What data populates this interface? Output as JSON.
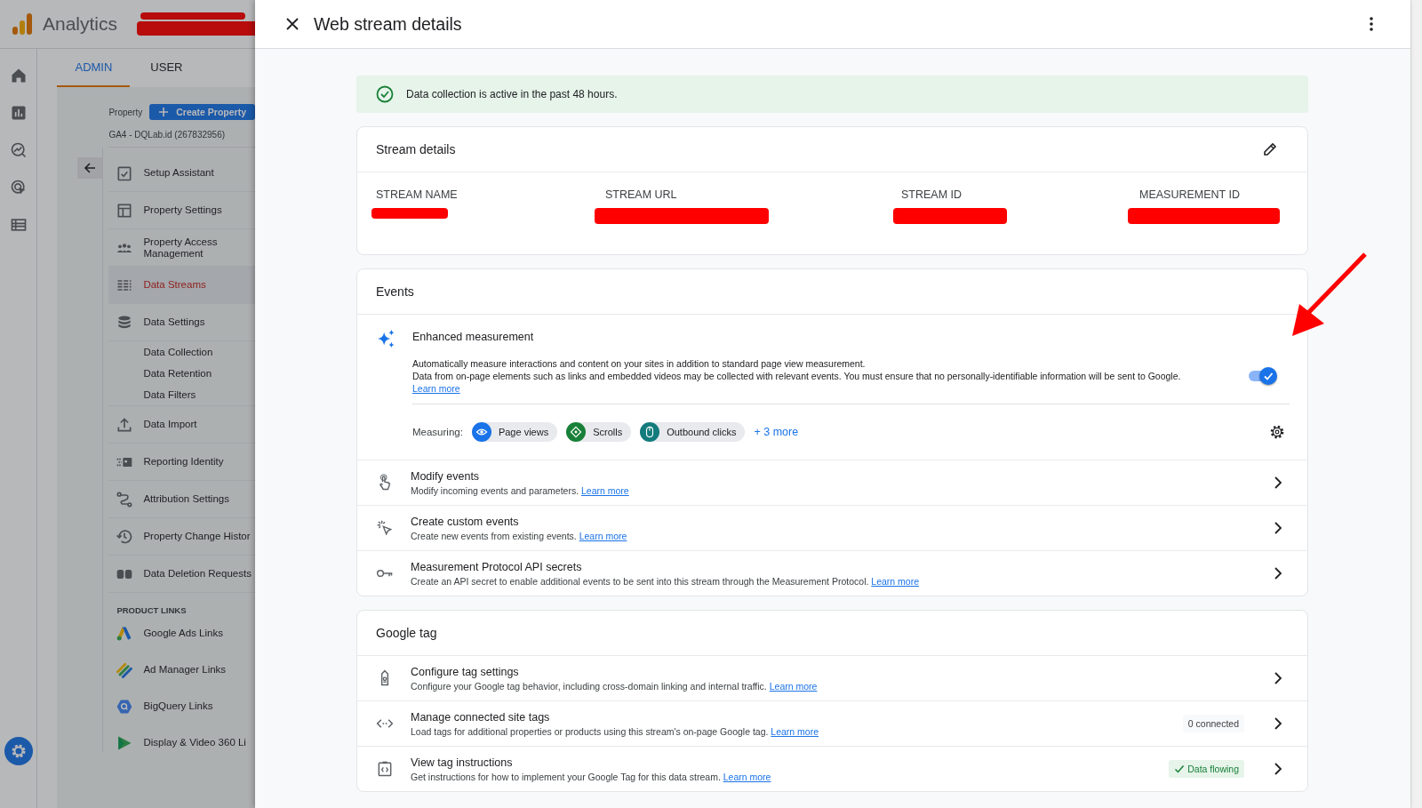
{
  "app": {
    "name": "Analytics",
    "property_redacted": true,
    "tabs": [
      {
        "label": "ADMIN",
        "selected": true
      },
      {
        "label": "USER",
        "selected": false
      }
    ],
    "property_label": "Property",
    "create_button": "Create Property",
    "property_name": "GA4 - DQLab.id (267832956)",
    "nav": [
      {
        "label": "Setup Assistant",
        "selected": false
      },
      {
        "label": "Property Settings",
        "selected": false
      },
      {
        "label": "Property Access Management",
        "selected": false
      },
      {
        "label": "Data Streams",
        "selected": true
      },
      {
        "label": "Data Settings",
        "selected": false,
        "children": [
          {
            "label": "Data Collection",
            "selected": false
          },
          {
            "label": "Data Retention",
            "selected": false
          },
          {
            "label": "Data Filters",
            "selected": false
          }
        ]
      },
      {
        "label": "Data Import",
        "selected": false
      },
      {
        "label": "Reporting Identity",
        "selected": false
      },
      {
        "label": "Attribution Settings",
        "selected": false
      },
      {
        "label": "Property Change Histor",
        "selected": false
      },
      {
        "label": "Data Deletion Requests",
        "selected": false
      }
    ],
    "links_heading": "PRODUCT LINKS",
    "product_links": [
      {
        "label": "Google Ads Links"
      },
      {
        "label": "Ad Manager Links"
      },
      {
        "label": "BigQuery Links"
      },
      {
        "label": "Display & Video 360 Li"
      }
    ]
  },
  "panel": {
    "title": "Web stream details",
    "banner": "Data collection is active in the past 48 hours.",
    "stream_details": {
      "title": "Stream details",
      "fields": [
        {
          "label": "STREAM NAME",
          "redacted": true
        },
        {
          "label": "STREAM URL",
          "redacted": true
        },
        {
          "label": "STREAM ID",
          "redacted": true
        },
        {
          "label": "MEASUREMENT ID",
          "redacted": true
        }
      ]
    },
    "events": {
      "title": "Events",
      "enhanced": {
        "title": "Enhanced measurement",
        "description": "Automatically measure interactions and content on your sites in addition to standard page view measurement.",
        "note": "Data from on-page elements such as links and embedded videos may be collected with relevant events. You must ensure that no personally-identifiable information will be sent to Google.",
        "link": "Learn more",
        "on": true,
        "measuring_label": "Measuring:",
        "chips": [
          {
            "label": "Page views",
            "color": "#1a73e8"
          },
          {
            "label": "Scrolls",
            "color": "#188038"
          },
          {
            "label": "Outbound clicks",
            "color": "#137b7c"
          }
        ],
        "more": "+ 3 more"
      },
      "rows": [
        {
          "title": "Modify events",
          "description": "Modify incoming events and parameters.",
          "link": "Learn more"
        },
        {
          "title": "Create custom events",
          "description": "Create new events from existing events.",
          "link": "Learn more"
        },
        {
          "title": "Measurement Protocol API secrets",
          "description": "Create an API secret to enable additional events to be sent into this stream through the Measurement Protocol.",
          "link": "Learn more"
        }
      ]
    },
    "google_tag": {
      "title": "Google tag",
      "rows": [
        {
          "title": "Configure tag settings",
          "description": "Configure your Google tag behavior, including cross-domain linking and internal traffic.",
          "link": "Learn more"
        },
        {
          "title": "Manage connected site tags",
          "description": "Load tags for additional properties or products using this stream's on-page Google tag.",
          "link": "Learn more",
          "badge": {
            "text": "0 connected",
            "kind": "neutral"
          }
        },
        {
          "title": "View tag instructions",
          "description": "Get instructions for how to implement your Google Tag for this data stream.",
          "link": "Learn more",
          "badge": {
            "text": "Data flowing",
            "kind": "success"
          }
        }
      ]
    }
  },
  "annotations": [
    {
      "kind": "arrow"
    }
  ]
}
